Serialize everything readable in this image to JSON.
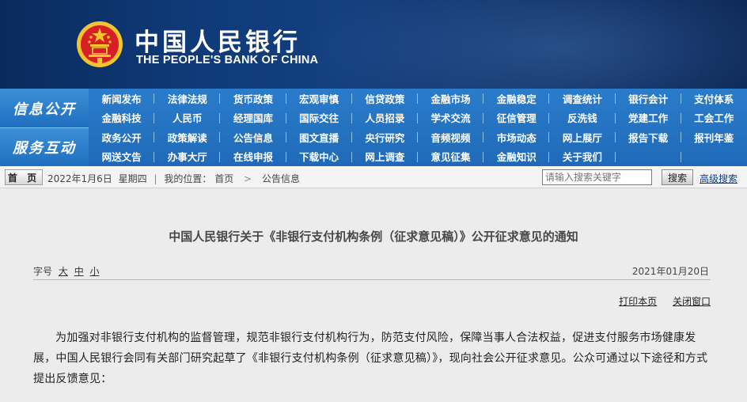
{
  "header": {
    "title_cn": "中国人民银行",
    "title_en": "THE PEOPLE'S BANK OF CHINA",
    "colors": {
      "bg": "#0f3a78",
      "emblem_red": "#d81f26",
      "emblem_gold": "#f4c430"
    },
    "emblem_icon": "national-emblem-icon"
  },
  "nav": {
    "section1_label": "信息公开",
    "section2_label": "服务互动",
    "rows": [
      [
        "新闻发布",
        "法律法规",
        "货币政策",
        "宏观审慎",
        "信贷政策",
        "金融市场",
        "金融稳定",
        "调查统计",
        "银行会计",
        "支付体系"
      ],
      [
        "金融科技",
        "人民币",
        "经理国库",
        "国际交往",
        "人员招录",
        "学术交流",
        "征信管理",
        "反洗钱",
        "党建工作",
        "工会工作"
      ],
      [
        "政务公开",
        "政策解读",
        "公告信息",
        "图文直播",
        "央行研究",
        "音频视频",
        "市场动态",
        "网上展厅",
        "报告下载",
        "报刊年鉴"
      ],
      [
        "网送文告",
        "办事大厅",
        "在线申报",
        "下载中心",
        "网上调查",
        "意见征集",
        "金融知识",
        "关于我们",
        "",
        ""
      ]
    ]
  },
  "breadcrumb": {
    "home": "首 页",
    "date": "2022年1月6日",
    "weekday": "星期四",
    "location_label": "我的位置：",
    "path": [
      "首页",
      "公告信息"
    ],
    "search_placeholder": "请输入搜索关键字",
    "search_button": "搜索",
    "advanced_search": "高级搜索"
  },
  "article": {
    "title": "中国人民银行关于《非银行支付机构条例（征求意见稿）》公开征求意见的通知",
    "font_size_label": "字号",
    "font_sizes": [
      "大",
      "中",
      "小"
    ],
    "date": "2021年01月20日",
    "print": "打印本页",
    "close": "关闭窗口",
    "body": "为加强对非银行支付机构的监督管理，规范非银行支付机构行为，防范支付风险，保障当事人合法权益，促进支付服务市场健康发展，中国人民银行会同有关部门研究起草了《非银行支付机构条例（征求意见稿）》，现向社会公开征求意见。公众可通过以下途径和方式提出反馈意见："
  }
}
